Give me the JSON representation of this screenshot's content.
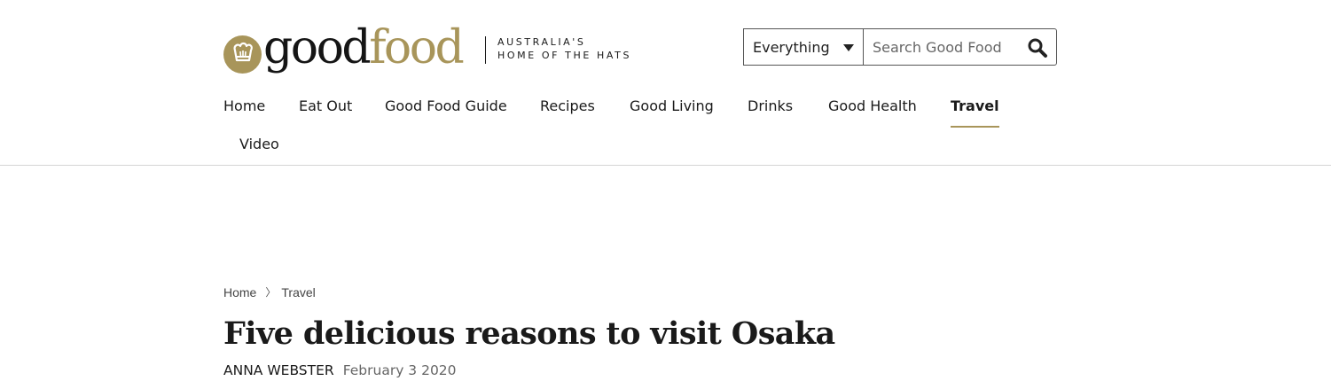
{
  "brand": {
    "logo_good": "good",
    "logo_food": "food",
    "tagline_line1": "AUSTRALIA'S",
    "tagline_line2": "HOME OF THE HATS",
    "accent_color": "#a8955a"
  },
  "search": {
    "scope_value": "Everything",
    "placeholder": "Search Good Food",
    "icon": "search-icon"
  },
  "nav": {
    "items": [
      {
        "label": "Home"
      },
      {
        "label": "Eat Out"
      },
      {
        "label": "Good Food Guide"
      },
      {
        "label": "Recipes"
      },
      {
        "label": "Good Living"
      },
      {
        "label": "Drinks"
      },
      {
        "label": "Good Health"
      },
      {
        "label": "Travel",
        "active": true
      },
      {
        "label": "Video"
      }
    ]
  },
  "breadcrumb": {
    "items": [
      "Home",
      "Travel"
    ],
    "separator": "〉"
  },
  "article": {
    "title": "Five delicious reasons to visit Osaka",
    "author": "ANNA WEBSTER",
    "date": "February 3 2020"
  }
}
